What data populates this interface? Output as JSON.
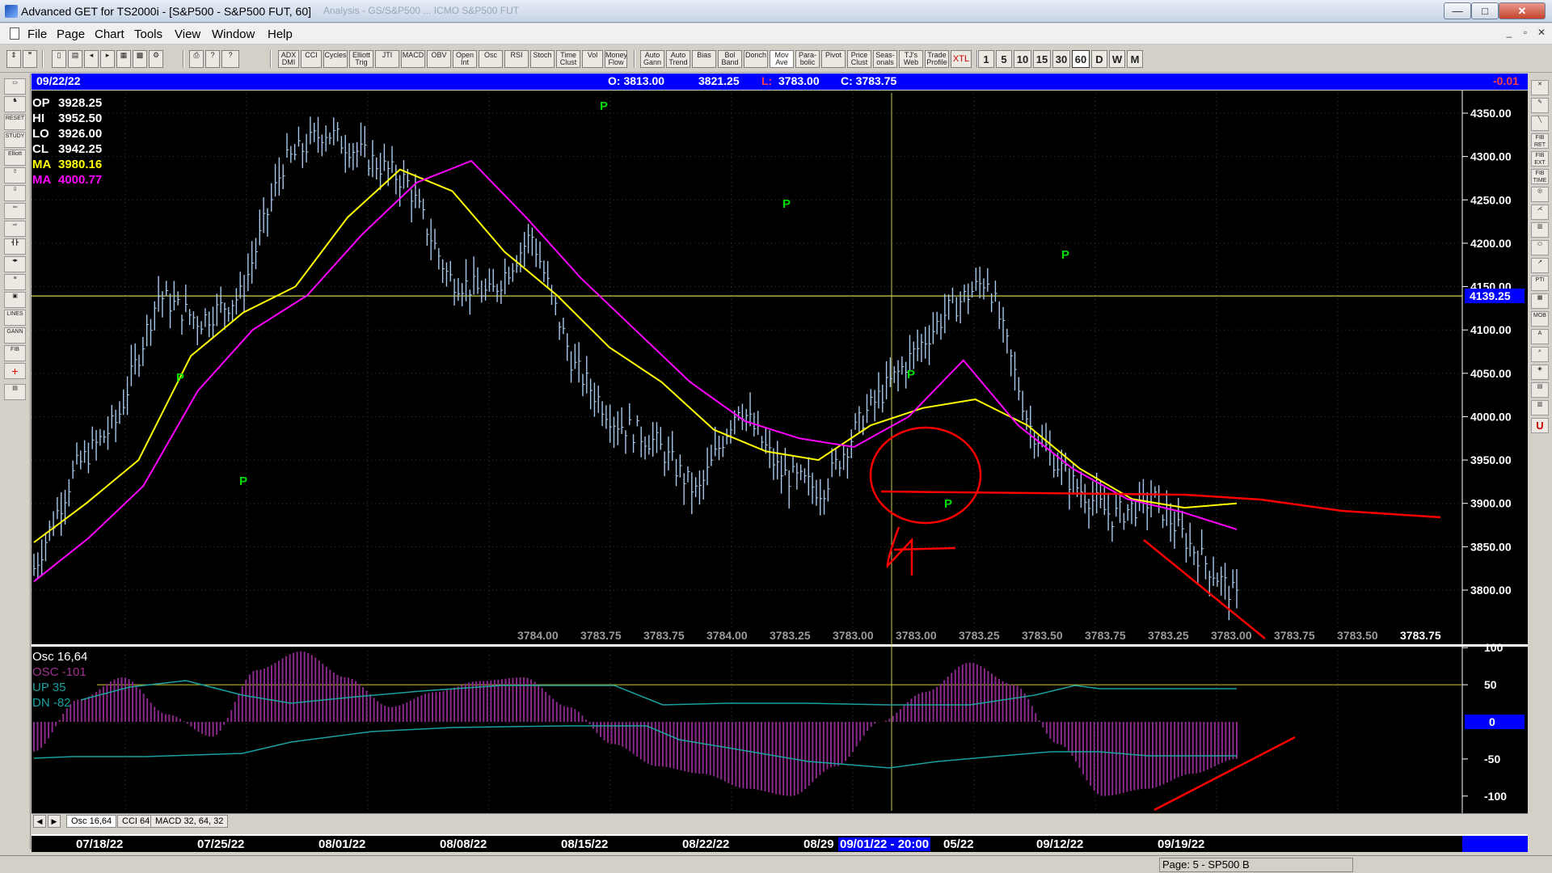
{
  "window": {
    "title": "Advanced GET for TS2000i - [S&P500 - S&P500 FUT, 60]",
    "blurred_subtitle": "Analysis - GS/S&P500 ... ICMO S&P500 FUT",
    "min_label": "—",
    "max_label": "□",
    "close_label": "✕"
  },
  "menu": [
    "File",
    "Page",
    "Chart",
    "Tools",
    "View",
    "Window",
    "Help"
  ],
  "toolbar": {
    "study_buttons": [
      "ADX DMI",
      "CCI",
      "Cycles",
      "Elliott Trig",
      "JTI",
      "MACD",
      "OBV",
      "Open Int",
      "Osc",
      "RSI",
      "Stoch",
      "Time Clust",
      "Vol",
      "Money Flow"
    ],
    "tool_buttons": [
      "Auto Gann",
      "Auto Trend",
      "Bias",
      "Bol Band",
      "Donch",
      "Mov Ave",
      "Para-bolic",
      "Pivot",
      "Price Clust",
      "Seas-onals",
      "TJ's Web",
      "Trade Profile",
      "XTL"
    ],
    "timeframes": [
      "1",
      "5",
      "10",
      "15",
      "30",
      "60",
      "D",
      "W",
      "M"
    ],
    "active_timeframe": "60"
  },
  "infobar": {
    "date": "09/22/22",
    "open": "O: 3813.00",
    "high": "3821.25",
    "low_label": "L:",
    "low": "3783.00",
    "close": "C: 3783.75",
    "change": "-0.01"
  },
  "legend": {
    "op_label": "OP",
    "op": "3928.25",
    "hi_label": "HI",
    "hi": "3952.50",
    "lo_label": "LO",
    "lo": "3926.00",
    "cl_label": "CL",
    "cl": "3942.25",
    "ma1_label": "MA",
    "ma1": "3980.16",
    "ma2_label": "MA",
    "ma2": "4000.77"
  },
  "osc_legend": {
    "title": "Osc 16,64",
    "osc": "OSC -101",
    "up": "UP  35",
    "dn": "DN  -82"
  },
  "price_axis": [
    "4350.00",
    "4300.00",
    "4250.00",
    "4200.00",
    "4150.00",
    "4100.00",
    "4050.00",
    "4000.00",
    "3950.00",
    "3900.00",
    "3850.00",
    "3800.00"
  ],
  "crosshair_price": "4139.25",
  "bottom_prices": [
    "3784.00",
    "3783.75",
    "3783.75",
    "3784.00",
    "3783.25",
    "3783.00",
    "3783.00",
    "3783.25",
    "3783.50",
    "3783.75",
    "3783.25",
    "3783.00",
    "3783.75",
    "3783.50",
    "3783.75"
  ],
  "pivot_marker": "P",
  "osc_axis": [
    "100",
    "50",
    "0",
    "-50",
    "-100"
  ],
  "tabs": [
    "Osc 16,64",
    "CCI 64",
    "MACD 32, 64, 32"
  ],
  "dates": [
    "07/18/22",
    "07/25/22",
    "08/01/22",
    "08/08/22",
    "08/15/22",
    "08/22/22",
    "08/29",
    "09/01/22 - 20:00",
    "05/22",
    "09/12/22",
    "09/19/22"
  ],
  "status": "Page: 5 - SP500 B",
  "colors": {
    "bars": "#a8c8ec",
    "ma_fast": "#ffff00",
    "ma_slow": "#ff00ff",
    "annotation": "#ff0000",
    "pivot": "#00dd00",
    "osc_hist": "#8b2a8b",
    "osc_line": "#1aa0a0",
    "infobar": "#0000ff"
  },
  "chart_data": {
    "type": "line",
    "title": "",
    "x_dates": [
      "07/18/22",
      "07/25/22",
      "08/01/22",
      "08/08/22",
      "08/15/22",
      "08/22/22",
      "08/29",
      "09/05/22",
      "09/12/22",
      "09/19/22"
    ],
    "series": [
      {
        "name": "",
        "values": [
          3825,
          3940,
          3995,
          4140,
          4110,
          4140,
          4290,
          4330,
          4300,
          4270,
          4160,
          4140,
          4210,
          4060,
          3995,
          3970,
          3910,
          4015,
          3935,
          3915,
          4000,
          4060,
          4120,
          4160,
          3990,
          3925,
          3885,
          3905,
          3845,
          3790
        ]
      },
      {
        "name": "",
        "values": [
          3855,
          3900,
          3950,
          4070,
          4120,
          4150,
          4230,
          4285,
          4260,
          4190,
          4140,
          4080,
          4040,
          3985,
          3960,
          3950,
          3990,
          4010,
          4020,
          3990,
          3940,
          3905,
          3895,
          3900
        ]
      },
      {
        "name": "",
        "values": [
          3810,
          3860,
          3920,
          4030,
          4100,
          4140,
          4210,
          4270,
          4295,
          4230,
          4160,
          4100,
          4040,
          3995,
          3975,
          3965,
          4000,
          4065,
          3990,
          3940,
          3905,
          3890,
          3870
        ]
      }
    ],
    "oscillator": {
      "title": "Osc 16,64",
      "values": [
        -40,
        30,
        60,
        10,
        -20,
        70,
        95,
        60,
        20,
        40,
        55,
        60,
        20,
        -30,
        -60,
        -70,
        -90,
        -100,
        -60,
        0,
        40,
        80,
        50,
        -30,
        -100,
        -90,
        -70,
        -50
      ],
      "ylim": [
        -120,
        110
      ]
    },
    "ylim": [
      3760,
      4370
    ],
    "grid": true
  }
}
